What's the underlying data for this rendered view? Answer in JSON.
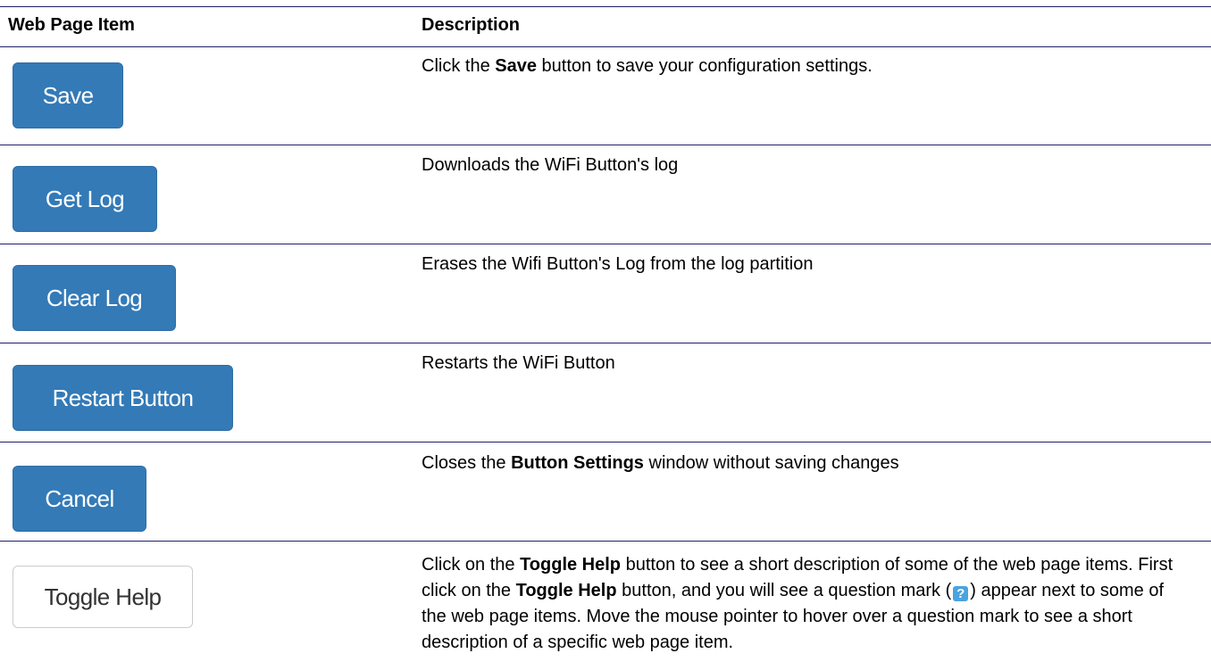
{
  "table": {
    "headers": {
      "item": "Web Page Item",
      "description": "Description"
    },
    "rows": [
      {
        "button_label": "Save",
        "button_style": "primary",
        "description": {
          "pre": "Click the ",
          "bold": "Save",
          "post": " button to save your configuration settings."
        }
      },
      {
        "button_label": "Get Log",
        "button_style": "primary",
        "description": {
          "text": "Downloads the WiFi Button's log"
        }
      },
      {
        "button_label": "Clear Log",
        "button_style": "primary",
        "description": {
          "text": "Erases the Wifi Button's Log from the log partition"
        }
      },
      {
        "button_label": "Restart Button",
        "button_style": "primary",
        "description": {
          "text": "Restarts the WiFi Button"
        }
      },
      {
        "button_label": "Cancel",
        "button_style": "primary",
        "description": {
          "pre": "Closes the ",
          "bold": "Button Settings",
          "post": " window without saving changes"
        }
      },
      {
        "button_label": "Toggle Help",
        "button_style": "default",
        "description": {
          "p1": "Click on the ",
          "b1": "Toggle Help",
          "p2": " button to see a short description of some of the web page items. First click on the ",
          "b2": "Toggle Help",
          "p3": " button, and you will see a question mark (",
          "icon": "?",
          "p4": ") appear next to some of the web page items. Move the mouse pointer to hover over a question mark to see a short description of a specific web page item."
        }
      }
    ]
  },
  "colors": {
    "primary_button": "#337ab7",
    "default_button": "#ffffff",
    "rule": "#1f1f6b",
    "help_icon": "#4aa3df"
  },
  "icons": {
    "help": "question-mark-icon"
  }
}
